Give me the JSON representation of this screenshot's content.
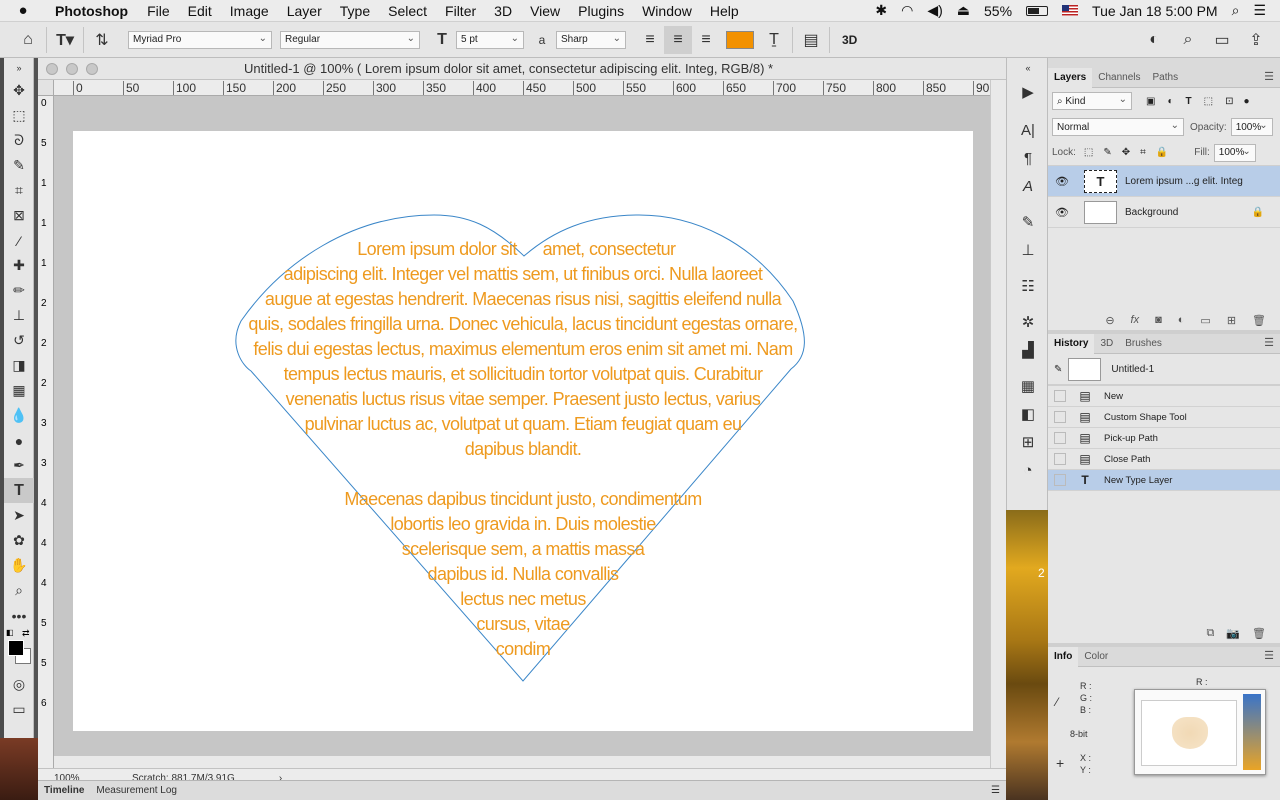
{
  "menubar": {
    "app_name": "Photoshop",
    "items": [
      "File",
      "Edit",
      "Image",
      "Layer",
      "Type",
      "Select",
      "Filter",
      "3D",
      "View",
      "Plugins",
      "Window",
      "Help"
    ],
    "battery": "55%",
    "datetime": "Tue Jan 18  5:00 PM"
  },
  "options": {
    "font_family": "Myriad Pro",
    "font_style": "Regular",
    "font_size": "5 pt",
    "antialias_icon_label": "a",
    "antialias": "Sharp",
    "text_color": "#f29100",
    "btn_3d": "3D"
  },
  "document": {
    "title": "Untitled-1 @ 100% ( Lorem ipsum dolor sit amet, consectetur adipiscing elit. Integ, RGB/8) *",
    "ruler_labels": [
      "0",
      "50",
      "100",
      "150",
      "200",
      "250",
      "300",
      "350",
      "400",
      "450",
      "500",
      "550",
      "600",
      "650",
      "700",
      "750",
      "800",
      "850",
      "90"
    ],
    "vruler_labels": [
      "0",
      "5",
      "1",
      "1",
      "1",
      "2",
      "2",
      "2",
      "3",
      "3",
      "4",
      "4",
      "4",
      "5",
      "5",
      "6"
    ],
    "text_color": "#ee9a1f",
    "heart_stroke": "#3a86c8",
    "text_lines": [
      "Lorem ipsum dolor sit",
      "amet, consectetur",
      "adipiscing elit. Integer vel mattis sem, ut finibus orci. Nulla laoreet",
      "augue at egestas hendrerit. Maecenas risus nisi, sagittis eleifend nulla",
      "quis, sodales fringilla urna. Donec vehicula, lacus tincidunt egestas ornare,",
      "felis dui egestas lectus, maximus elementum eros enim sit amet mi. Nam",
      "tempus lectus mauris, et sollicitudin tortor volutpat quis. Curabitur",
      "venenatis luctus risus vitae semper. Praesent justo lectus, varius",
      "pulvinar luctus ac, volutpat ut quam. Etiam feugiat quam eu",
      "dapibus blandit.",
      "Maecenas dapibus tincidunt justo, condimentum",
      "lobortis leo gravida in. Duis molestie",
      "scelerisque sem, a mattis massa",
      "dapibus id. Nulla convallis",
      "lectus nec metus",
      "cursus, vitae",
      "condim"
    ],
    "zoom": "100%",
    "scratch": "Scratch: 881.7M/3.91G"
  },
  "bottom_tabs": [
    "Timeline",
    "Measurement Log"
  ],
  "layers_panel": {
    "tabs": [
      "Layers",
      "Channels",
      "Paths"
    ],
    "filter": "Kind",
    "blend_mode": "Normal",
    "opacity_label": "Opacity:",
    "opacity": "100%",
    "lock_label": "Lock:",
    "fill_label": "Fill:",
    "fill": "100%",
    "layers": [
      {
        "name": "Lorem ipsum ...g elit. Integ",
        "thumb": "T"
      },
      {
        "name": "Background",
        "thumb": ""
      }
    ]
  },
  "history_panel": {
    "tabs": [
      "History",
      "3D",
      "Brushes"
    ],
    "snapshot": "Untitled-1",
    "items": [
      "New",
      "Custom Shape Tool",
      "Pick-up Path",
      "Close Path",
      "New Type Layer"
    ]
  },
  "info_panel": {
    "tabs": [
      "Info",
      "Color"
    ],
    "r": "R :",
    "g": "G :",
    "b": "B :",
    "r2": "R :",
    "bitdepth": "8-bit",
    "x": "X :",
    "y": "Y :"
  },
  "strip_label": "2"
}
